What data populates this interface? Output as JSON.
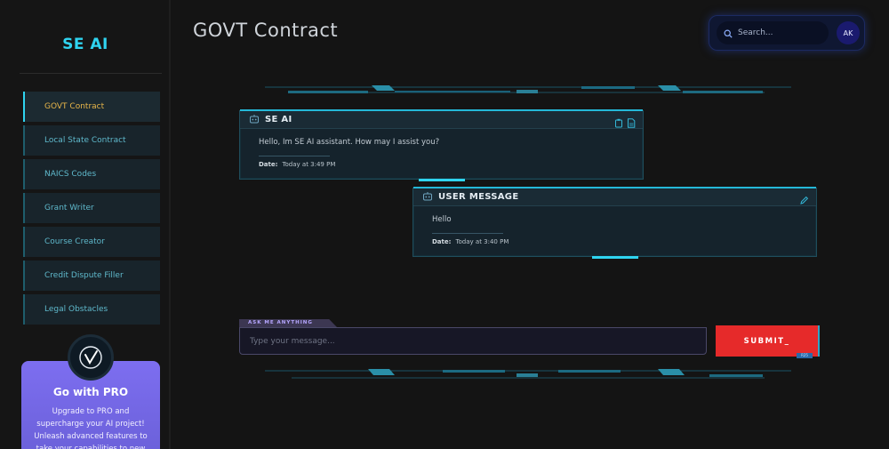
{
  "brand": "SE AI",
  "nav": [
    {
      "label": "GOVT Contract",
      "active": true
    },
    {
      "label": "Local State Contract",
      "active": false
    },
    {
      "label": "NAICS Codes",
      "active": false
    },
    {
      "label": "Grant Writer",
      "active": false
    },
    {
      "label": "Course Creator",
      "active": false
    },
    {
      "label": "Credit Dispute Filler",
      "active": false
    },
    {
      "label": "Legal Obstacles",
      "active": false
    }
  ],
  "pro": {
    "title": "Go with PRO",
    "text": "Upgrade to PRO and supercharge your AI project! Unleash advanced features to take your capabilities to new"
  },
  "header": {
    "title": "GOVT Contract",
    "search_placeholder": "Search...",
    "avatar_initials": "AK"
  },
  "messages": [
    {
      "sender": "SE AI",
      "text": "Hello, Im SE AI assistant. How may I assist you?",
      "date_label": "Date:",
      "date_value": "Today at 3:49 PM"
    },
    {
      "sender": "USER MESSAGE",
      "text": "Hello",
      "date_label": "Date:",
      "date_value": "Today at 3:40 PM"
    }
  ],
  "composer": {
    "tag": "ASK ME ANYTHING",
    "placeholder": "Type your message...",
    "submit_label": "SUBMIT_",
    "submit_tag": "R25"
  },
  "colors": {
    "accent": "#2fd4f0",
    "active_nav_text": "#e8b64a",
    "submit": "#e62a2a",
    "pro_card": "#7d6ef0"
  }
}
